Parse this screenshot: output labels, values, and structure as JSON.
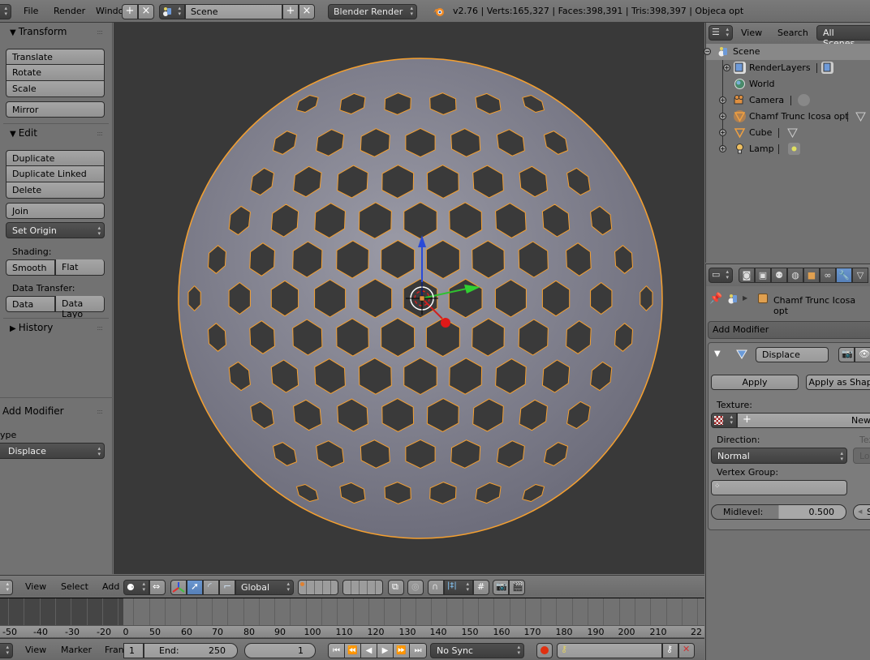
{
  "topbar": {
    "menus": [
      "File",
      "Render",
      "Windo"
    ],
    "scene_name": "Scene",
    "render_engine": "Blender Render",
    "stats": "v2.76 | Verts:165,327 | Faces:398,391 | Tris:398,397 | Objeca opt"
  },
  "toolshelf": {
    "transform": {
      "title": "Transform",
      "buttons": [
        "Translate",
        "Rotate",
        "Scale"
      ],
      "mirror": "Mirror"
    },
    "edit": {
      "title": "Edit",
      "buttons": [
        "Duplicate",
        "Duplicate Linked",
        "Delete"
      ],
      "join": "Join",
      "set_origin": "Set Origin",
      "shading_label": "Shading:",
      "shading_buttons": [
        "Smooth",
        "Flat"
      ],
      "data_transfer_label": "Data Transfer:",
      "data_transfer_buttons": [
        "Data",
        "Data Layo"
      ]
    },
    "history": {
      "title": "History"
    },
    "operator": {
      "title": "Add Modifier",
      "type_label": "ype",
      "type_value": "Displace"
    }
  },
  "viewport_header": {
    "menus": [
      "View",
      "Select",
      "Add"
    ],
    "orientation": "Global"
  },
  "timeline": {
    "ticks": [
      -50,
      -40,
      -30,
      -20,
      0,
      50,
      60,
      70,
      80,
      90,
      100,
      110,
      120,
      130,
      140,
      150,
      160,
      170,
      180,
      190,
      200,
      210,
      "22"
    ],
    "menus": [
      "View",
      "Marker",
      "Fran"
    ],
    "start_frame": "1",
    "end_label": "End:",
    "end_frame": "250",
    "current_frame": "1",
    "sync": "No Sync"
  },
  "outliner": {
    "menus": [
      "View",
      "Search"
    ],
    "display_mode": "All Scenes",
    "items": [
      {
        "name": "Scene",
        "icon": "scene-icon",
        "depth": 0
      },
      {
        "name": "RenderLayers",
        "icon": "render-layers-icon",
        "depth": 1
      },
      {
        "name": "World",
        "icon": "world-icon",
        "depth": 1
      },
      {
        "name": "Camera",
        "icon": "camera-icon",
        "depth": 1
      },
      {
        "name": "Chamf Trunc Icosa opt",
        "icon": "mesh-icon",
        "depth": 1
      },
      {
        "name": "Cube",
        "icon": "mesh-icon",
        "depth": 1
      },
      {
        "name": "Lamp",
        "icon": "lamp-icon",
        "depth": 1
      }
    ]
  },
  "properties": {
    "breadcrumb_object": "Chamf Trunc Icosa opt",
    "add_modifier": "Add Modifier",
    "modifier": {
      "name": "Displace",
      "apply": "Apply",
      "apply_as_shape": "Apply as Shape",
      "texture_label": "Texture:",
      "texture_new": "New",
      "direction_label": "Direction:",
      "direction_value": "Normal",
      "texture_coords_label": "Tex",
      "texture_coords_value": "Loc",
      "vertex_group_label": "Vertex Group:",
      "midlevel_label": "Midlevel:",
      "midlevel_value": "0.500",
      "strength_label": "S"
    }
  },
  "colors": {
    "selection_outline": "#f5a030",
    "active_blue": "#5680b8",
    "viewport_bg": "#393939"
  }
}
